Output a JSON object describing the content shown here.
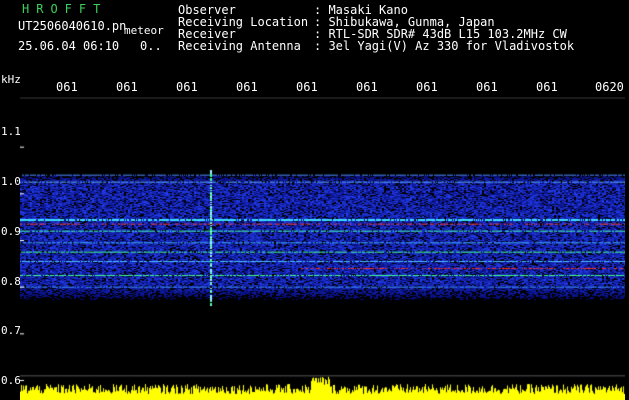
{
  "header": {
    "logo": "HROFFT",
    "filename": "UT2506040610.pn",
    "meteor": "meteor",
    "datetime": "25.06.04 06:10",
    "datetime_extra": "0..",
    "rows": [
      {
        "label": "Observer",
        "value": ": Masaki Kano"
      },
      {
        "label": "Receiving Location",
        "value": ": Shibukawa, Gunma, Japan"
      },
      {
        "label": "Receiver",
        "value": ": RTL-SDR SDR# 43dB L15 103.2MHz CW"
      },
      {
        "label": "Receiving Antenna",
        "value": ": 3el Yagi(V) Az 330 for Vladivostok"
      }
    ]
  },
  "time_axis": {
    "labels": [
      "061",
      "061",
      "061",
      "061",
      "061",
      "061",
      "061",
      "061",
      "061",
      "0620"
    ]
  },
  "freq_axis": {
    "unit": "kHz",
    "labels": [
      "1.1",
      "1.0",
      "0.9",
      "0.8",
      "0.7",
      "0.6"
    ],
    "range": [
      0.58,
      1.18
    ]
  },
  "colors": {
    "background": "#000000",
    "logo": "#3cd05a",
    "noise_strip": "#ffff00",
    "signal_low": "#1a3cff",
    "signal_mid": "#4cc0ff",
    "signal_high": "#ff3020"
  }
}
